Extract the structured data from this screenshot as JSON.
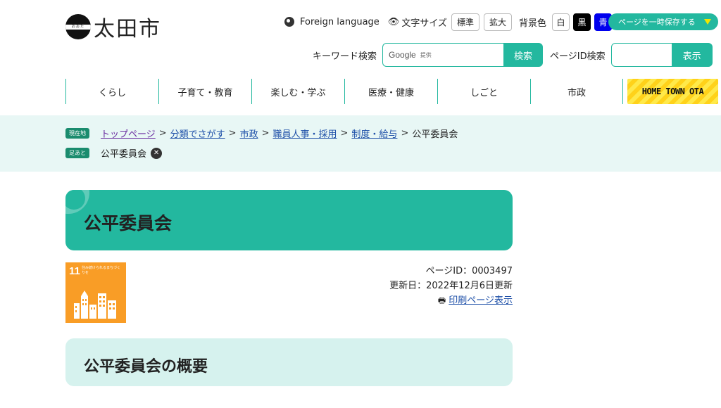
{
  "header": {
    "logo_small": "おおた",
    "logo_text": "太田市",
    "foreign_language": "Foreign language",
    "text_size_label": "文字サイズ",
    "size_standard": "標準",
    "size_large": "拡大",
    "bg_label": "背景色",
    "bg_white": "白",
    "bg_black": "黒",
    "bg_blue": "青",
    "save_page": "ページを一時保存する",
    "keyword_label": "キーワード検索",
    "google": "Google",
    "provided": "提供",
    "search_button": "検索",
    "page_id_label": "ページID検索",
    "display_button": "表示"
  },
  "nav": {
    "items": [
      "くらし",
      "子育て・教育",
      "楽しむ・学ぶ",
      "医療・健康",
      "しごと",
      "市政"
    ],
    "hometown": "HOME TOWN OTA"
  },
  "breadcrumb": {
    "current_tag": "現在地",
    "links": [
      "トップページ",
      "分類でさがす",
      "市政",
      "職員人事・採用",
      "制度・給与"
    ],
    "current": "公平委員会",
    "history_tag": "足あと",
    "history_item": "公平委員会"
  },
  "page": {
    "title": "公平委員会",
    "page_id": "ページID：0003497",
    "updated": "更新日：2022年12月6日更新",
    "print": "印刷ページ表示",
    "section_title": "公平委員会の概要"
  },
  "sdg": {
    "number": "11",
    "text": "住み続けられるまちづくりを"
  },
  "colors": {
    "accent": "#23b89f",
    "breadcrumb_bg": "#e8f7f5",
    "section_bg": "#d6f2ee",
    "sdg_orange": "#f99d26"
  }
}
